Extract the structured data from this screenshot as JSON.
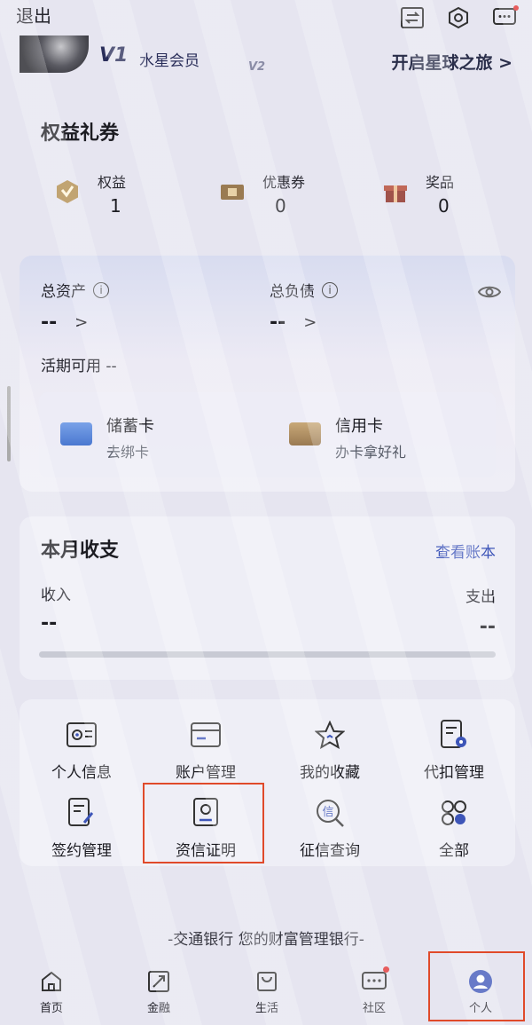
{
  "topbar": {
    "exit_label": "退出"
  },
  "member": {
    "level_badge": "V1",
    "level_name": "水星会员",
    "next_level": "V2",
    "journey_link": "开启星球之旅 >"
  },
  "rights": {
    "title": "权益礼券",
    "items": [
      {
        "label": "权益",
        "value": "1",
        "icon": "rights-badge-icon"
      },
      {
        "label": "优惠券",
        "value": "0",
        "icon": "coupon-icon"
      },
      {
        "label": "奖品",
        "value": "0",
        "icon": "gift-icon"
      }
    ]
  },
  "assets": {
    "total_assets_label": "总资产",
    "total_assets_value": "--",
    "total_liabilities_label": "总负债",
    "total_liabilities_value": "--",
    "current_available": "活期可用 --",
    "debit_card": {
      "title": "储蓄卡",
      "subtitle": "去绑卡"
    },
    "credit_card": {
      "title": "信用卡",
      "subtitle": "办卡拿好礼"
    }
  },
  "monthly": {
    "title": "本月收支",
    "view_bill": "查看账本",
    "income_label": "收入",
    "income_value": "--",
    "expense_label": "支出",
    "expense_value": "--"
  },
  "services": [
    {
      "label": "个人信息",
      "icon": "id-card-icon"
    },
    {
      "label": "账户管理",
      "icon": "card-icon"
    },
    {
      "label": "我的收藏",
      "icon": "star-icon"
    },
    {
      "label": "代扣管理",
      "icon": "document-gear-icon"
    },
    {
      "label": "签约管理",
      "icon": "sign-document-icon"
    },
    {
      "label": "资信证明",
      "icon": "credit-certificate-icon"
    },
    {
      "label": "征信查询",
      "icon": "credit-search-icon"
    },
    {
      "label": "全部",
      "icon": "all-icon"
    }
  ],
  "slogan": "-交通银行 您的财富管理银行-",
  "nav": [
    {
      "label": "首页",
      "icon": "home-icon"
    },
    {
      "label": "金融",
      "icon": "finance-icon"
    },
    {
      "label": "生活",
      "icon": "shopping-bag-icon"
    },
    {
      "label": "社区",
      "icon": "community-icon"
    },
    {
      "label": "个人",
      "icon": "person-icon"
    }
  ],
  "colors": {
    "accent_blue": "#3d55b8",
    "highlight_red": "#e04a2a",
    "notification_red": "#e03030"
  }
}
